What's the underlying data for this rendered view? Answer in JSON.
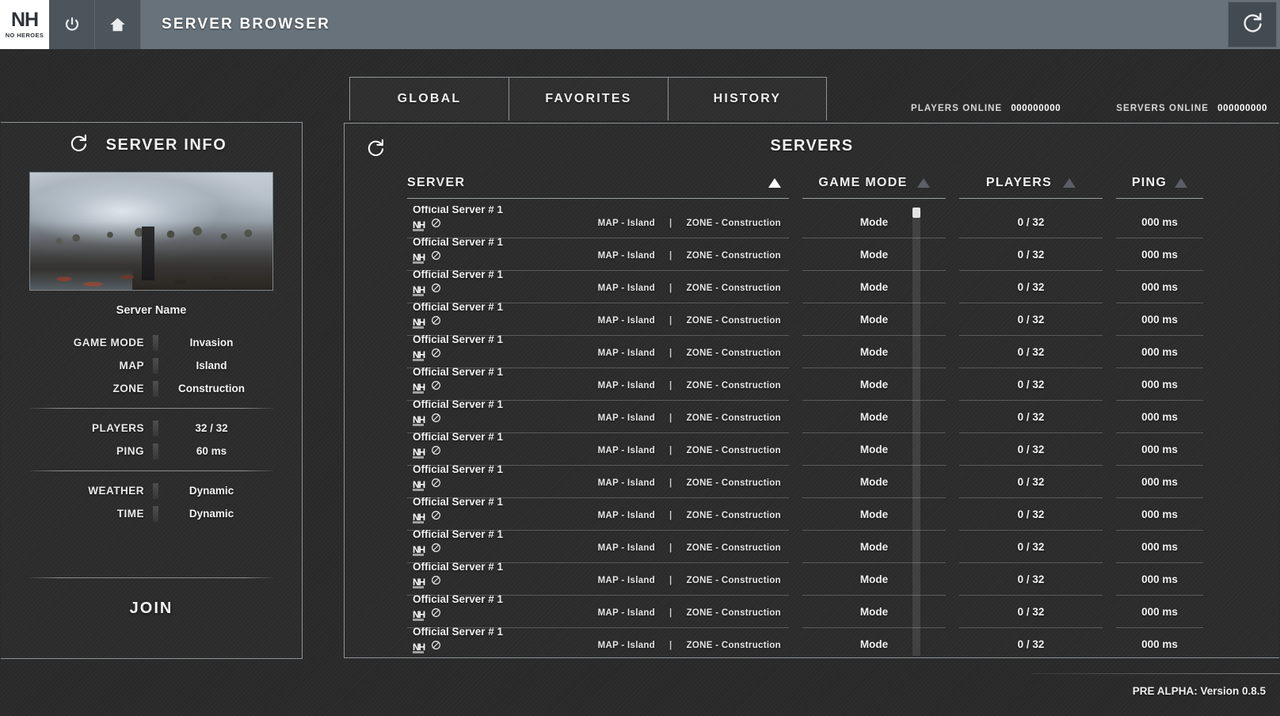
{
  "header": {
    "logo_main": "NH",
    "logo_sub": "NO HEROES",
    "power_icon": "power-icon",
    "home_icon": "home-icon",
    "title": "SERVER BROWSER",
    "refresh_icon": "refresh-icon"
  },
  "tabs": [
    {
      "label": "GLOBAL"
    },
    {
      "label": "FAVORITES"
    },
    {
      "label": "HISTORY"
    }
  ],
  "online_stats": {
    "players_label": "PLAYERS ONLINE",
    "players_value": "000000000",
    "servers_label": "SERVERS ONLINE",
    "servers_value": "000000000"
  },
  "server_info": {
    "title": "SERVER INFO",
    "refresh_icon": "refresh-icon",
    "server_name": "Server Name",
    "rows_top": [
      {
        "label": "GAME MODE",
        "value": "Invasion"
      },
      {
        "label": "MAP",
        "value": "Island"
      },
      {
        "label": "ZONE",
        "value": "Construction"
      }
    ],
    "rows_mid": [
      {
        "label": "PLAYERS",
        "value": "32 / 32"
      },
      {
        "label": "PING",
        "value": "60 ms"
      }
    ],
    "rows_bottom": [
      {
        "label": "WEATHER",
        "value": "Dynamic"
      },
      {
        "label": "TIME",
        "value": "Dynamic"
      }
    ],
    "join_label": "JOIN"
  },
  "servers_panel": {
    "title": "SERVERS",
    "refresh_icon": "refresh-icon",
    "columns": [
      {
        "label": "SERVER",
        "sort_active": true
      },
      {
        "label": "GAME MODE",
        "sort_active": false
      },
      {
        "label": "PLAYERS",
        "sort_active": false
      },
      {
        "label": "PING",
        "sort_active": false
      }
    ],
    "row_template": {
      "name": "Official Server # 1",
      "badge": "NH",
      "status_icon": "no-entry-icon",
      "map_text": "MAP - Island",
      "separator": "|",
      "zone_text": "ZONE - Construction",
      "mode": "Mode",
      "players": "0 / 32",
      "ping": "000 ms"
    },
    "row_count": 14
  },
  "footer": {
    "version_text": "PRE ALPHA: Version 0.8.5"
  },
  "colors": {
    "header_bar": "#68727a",
    "panel_border": "#8d949a",
    "background": "#2b2b2b",
    "text": "#f0f0f0",
    "sort_active": "#ffffff",
    "sort_inactive": "#5c6065"
  }
}
